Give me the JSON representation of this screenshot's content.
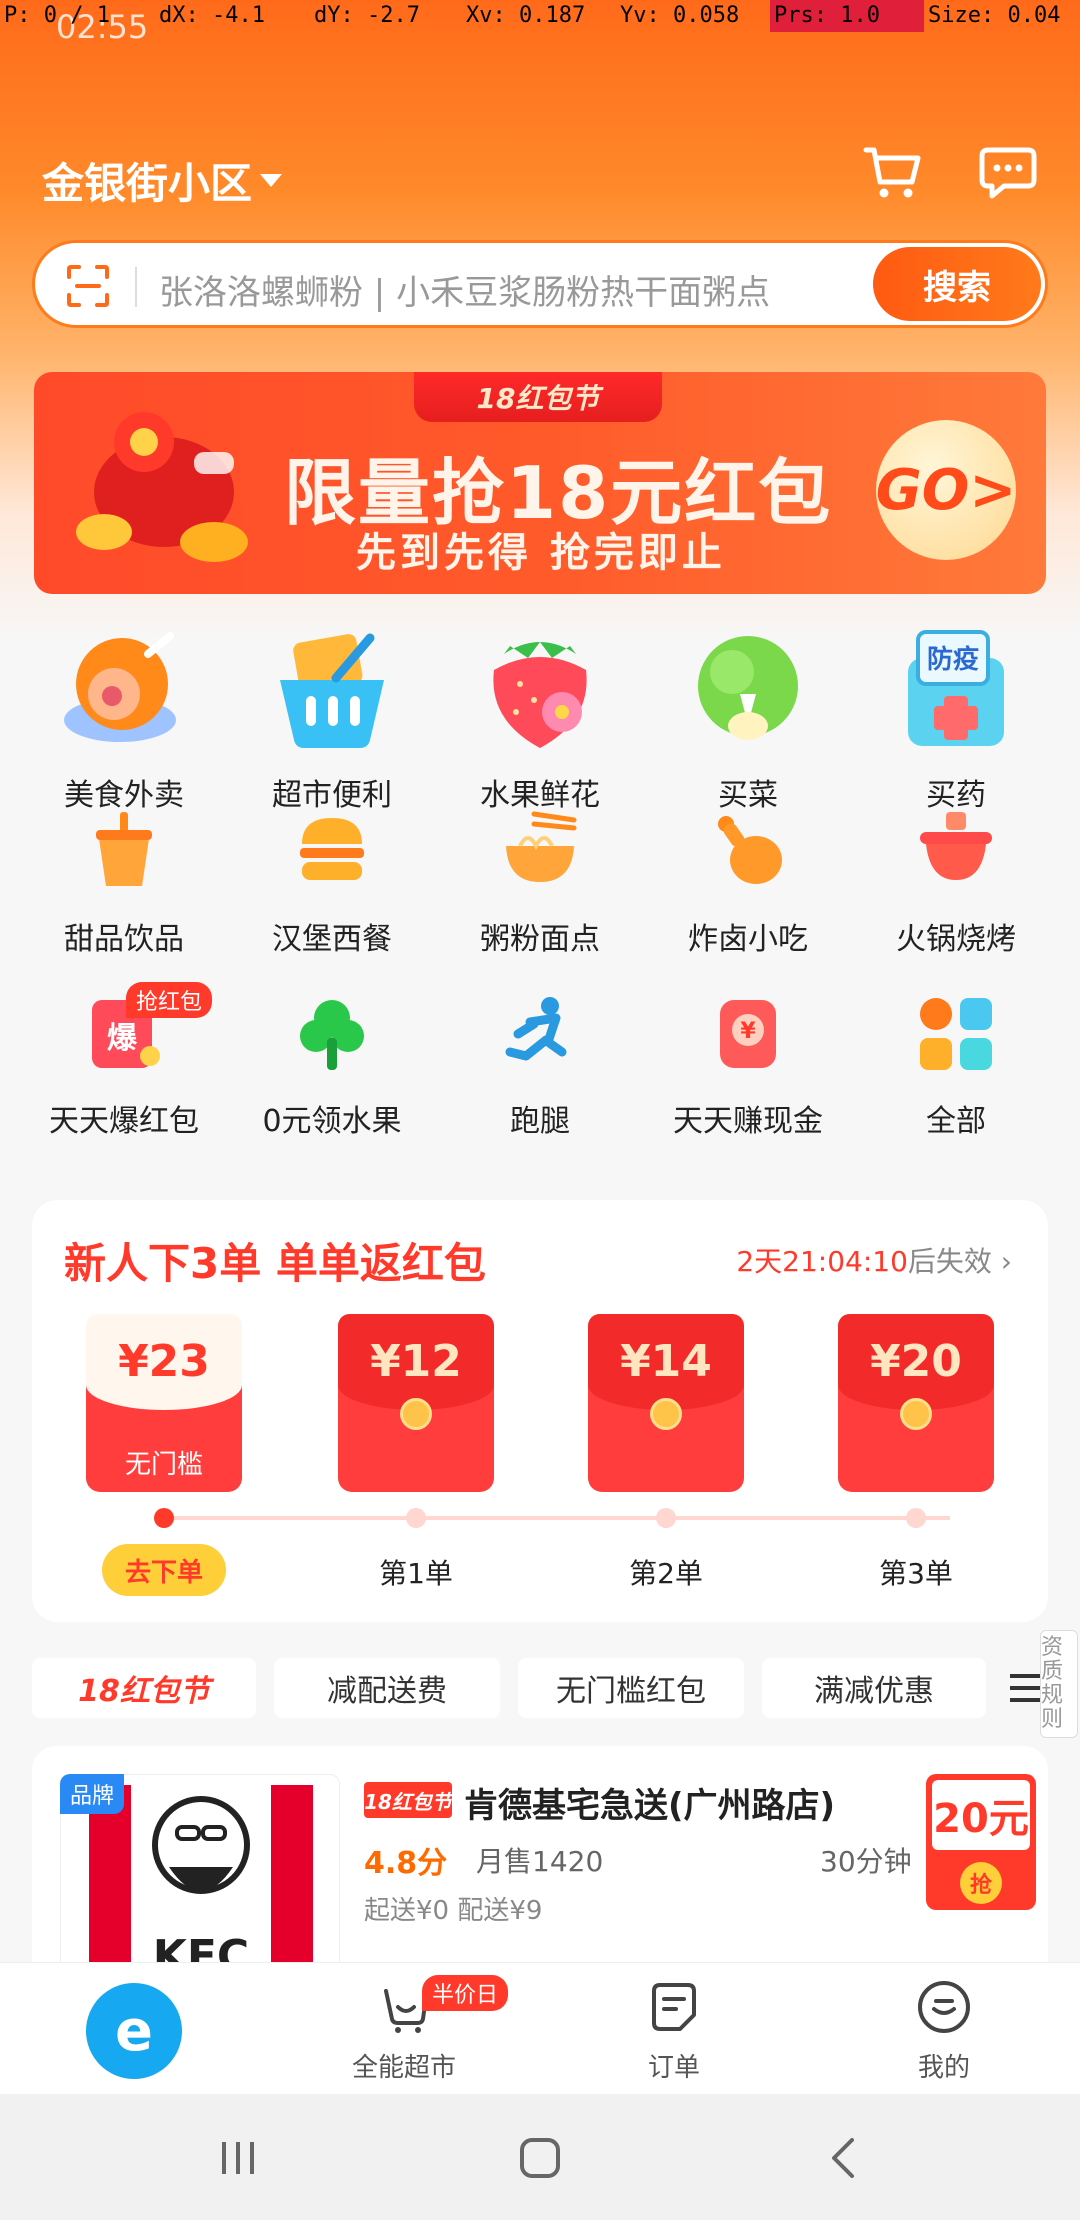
{
  "debug": {
    "pointer": "P: 0 / 1",
    "dx": "dX: -4.1",
    "dy": "dY: -2.7",
    "xv": "Xv: 0.187",
    "yv": "Yv: 0.058",
    "prs": "Prs: 1.0",
    "size": "Size: 0.04"
  },
  "status": {
    "time": "02:55"
  },
  "header": {
    "location": "金银街小区",
    "cart_icon": "cart-icon",
    "message_icon": "message-icon"
  },
  "search": {
    "placeholder": "张洛洛螺蛳粉 | 小禾豆浆肠粉热干面粥点",
    "button_label": "搜索",
    "scan_icon": "scan-icon"
  },
  "banner": {
    "tag": "18红包节",
    "title": "限量抢18元红包",
    "subtitle": "先到先得 抢完即止",
    "go_label": "GO>"
  },
  "categories": [
    {
      "label": "美食外卖",
      "icon": "food-icon"
    },
    {
      "label": "超市便利",
      "icon": "basket-icon"
    },
    {
      "label": "水果鲜花",
      "icon": "strawberry-icon"
    },
    {
      "label": "买菜",
      "icon": "vegetable-icon"
    },
    {
      "label": "买药",
      "icon": "medicine-icon",
      "icon_text": "防疫"
    },
    {
      "label": "甜品饮品",
      "icon": "drink-icon"
    },
    {
      "label": "汉堡西餐",
      "icon": "burger-icon"
    },
    {
      "label": "粥粉面点",
      "icon": "noodle-icon"
    },
    {
      "label": "炸卤小吃",
      "icon": "drumstick-icon"
    },
    {
      "label": "火锅烧烤",
      "icon": "hotpot-icon"
    },
    {
      "label": "天天爆红包",
      "icon": "redpacket-icon",
      "badge": "抢红包",
      "icon_text": "爆"
    },
    {
      "label": "0元领水果",
      "icon": "tree-icon"
    },
    {
      "label": "跑腿",
      "icon": "runner-icon"
    },
    {
      "label": "天天赚现金",
      "icon": "cash-icon"
    },
    {
      "label": "全部",
      "icon": "grid-icon"
    }
  ],
  "new_user": {
    "title": "新人下3单 单单返红包",
    "timer": "2天21:04:10",
    "timer_suffix": "后失效 ›",
    "packets": [
      {
        "amount": "¥23",
        "note": "无门槛"
      },
      {
        "amount": "¥12",
        "note": ""
      },
      {
        "amount": "¥14",
        "note": ""
      },
      {
        "amount": "¥20",
        "note": ""
      }
    ],
    "steps": [
      "去下单",
      "第1单",
      "第2单",
      "第3单"
    ],
    "progress_index": 0
  },
  "filters": [
    "18红包节",
    "减配送费",
    "无门槛红包",
    "满减优惠"
  ],
  "side_rule": "资质规则",
  "store": {
    "badge": "品牌",
    "tag": "18红包节",
    "name": "肯德基宅急送(广州路店)",
    "rating": "4.8分",
    "sales": "月售1420",
    "time": "30分钟",
    "fees": "起送¥0  配送¥9",
    "coupon": "20元",
    "coupon_btn": "抢",
    "logo_text": "KFC"
  },
  "bottom_nav": {
    "home_glyph": "e",
    "items": [
      {
        "label": "全能超市",
        "badge": "半价日",
        "icon": "cart-bag-icon"
      },
      {
        "label": "订单",
        "icon": "order-icon"
      },
      {
        "label": "我的",
        "icon": "profile-icon"
      }
    ]
  },
  "colors": {
    "brand_orange": "#ff6a1a",
    "red": "#ff3a2a",
    "blue": "#16a8f0"
  }
}
